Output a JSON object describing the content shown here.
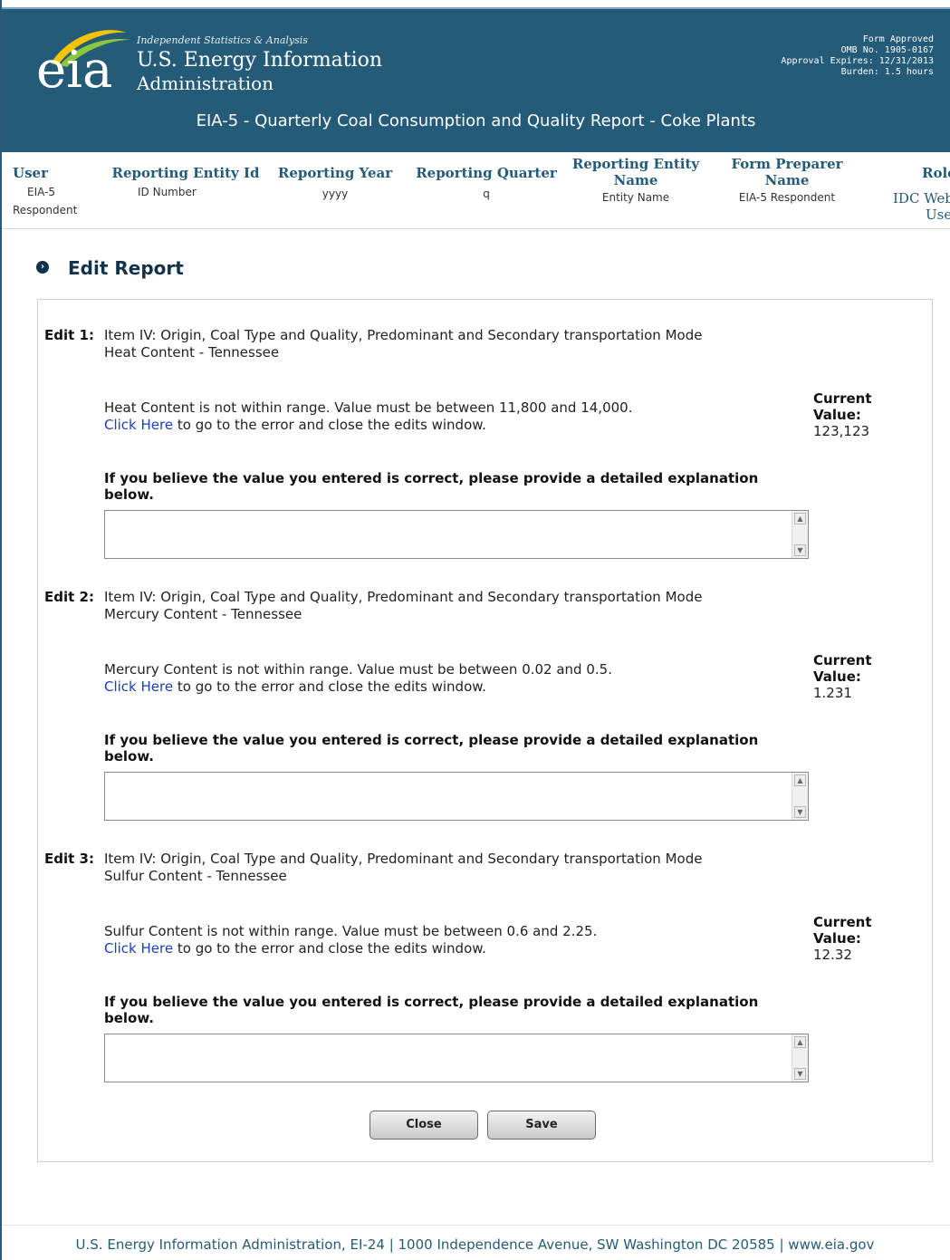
{
  "header": {
    "logo_mark": "eia",
    "tagline": "Independent Statistics & Analysis",
    "agency_line1": "U.S. Energy Information",
    "agency_line2": "Administration",
    "form_approved": [
      "Form Approved",
      "OMB No. 1905-0167",
      "Approval Expires: 12/31/2013",
      "Burden: 1.5 hours"
    ],
    "form_title": "EIA-5 - Quarterly Coal Consumption and Quality Report - Coke Plants"
  },
  "info": {
    "user_label": "User",
    "user_value_1": "EIA-5",
    "user_value_2": "Respondent",
    "entity_id_label": "Reporting Entity Id",
    "entity_id_value": "ID Number",
    "year_label": "Reporting Year",
    "year_value": "yyyy",
    "quarter_label": "Reporting Quarter",
    "quarter_value": "q",
    "entity_name_label_1": "Reporting Entity",
    "entity_name_label_2": "Name",
    "entity_name_value": "Entity Name",
    "preparer_label_1": "Form Preparer",
    "preparer_label_2": "Name",
    "preparer_value": "EIA-5 Respondent",
    "role_label": "Role",
    "role_value_1": "IDC Web",
    "role_value_2": "User"
  },
  "page": {
    "bullet": "›",
    "heading": "Edit Report"
  },
  "edits": [
    {
      "label": "Edit 1:",
      "item_line1": "Item IV: Origin, Coal Type and Quality, Predominant and Secondary transportation Mode",
      "item_line2": "Heat Content - Tennessee",
      "message": "Heat Content is not within range. Value must be between 11,800 and 14,000.",
      "link_text": "Click Here",
      "link_suffix": " to go to the error and close the edits window.",
      "current_label_1": "Current",
      "current_label_2": "Value:",
      "current_value": "123,123",
      "explain": "If you believe the value you entered is correct, please provide a detailed explanation below.",
      "explanation_value": ""
    },
    {
      "label": "Edit 2:",
      "item_line1": "Item IV: Origin, Coal Type and Quality, Predominant and Secondary transportation Mode",
      "item_line2": "Mercury Content - Tennessee",
      "message": "Mercury Content is not within range. Value must be between 0.02 and 0.5.",
      "link_text": "Click Here",
      "link_suffix": " to go to the error and close the edits window.",
      "current_label_1": "Current",
      "current_label_2": "Value:",
      "current_value": "1.231",
      "explain": "If you believe the value you entered is correct, please provide a detailed explanation below.",
      "explanation_value": ""
    },
    {
      "label": "Edit 3:",
      "item_line1": "Item IV: Origin, Coal Type and Quality, Predominant and Secondary transportation Mode",
      "item_line2": "Sulfur Content - Tennessee",
      "message": "Sulfur Content is not within range. Value must be between 0.6 and 2.25.",
      "link_text": "Click Here",
      "link_suffix": " to go to the error and close the edits window.",
      "current_label_1": "Current",
      "current_label_2": "Value:",
      "current_value": "12.32",
      "explain": "If you believe the value you entered is correct, please provide a detailed explanation below.",
      "explanation_value": ""
    }
  ],
  "buttons": {
    "close": "Close",
    "save": "Save"
  },
  "footer": {
    "text": "U.S. Energy Information Administration, EI-24 | 1000 Independence Avenue, SW Washington DC 20585  | www.eia.gov"
  },
  "colors": {
    "banner": "#245b78",
    "link": "#1a3fbd",
    "heading": "#11324a"
  },
  "icons": {
    "heading_bullet": "chevron-circle-icon",
    "scroll_up": "scroll-up-arrow-icon",
    "scroll_down": "scroll-down-arrow-icon"
  }
}
